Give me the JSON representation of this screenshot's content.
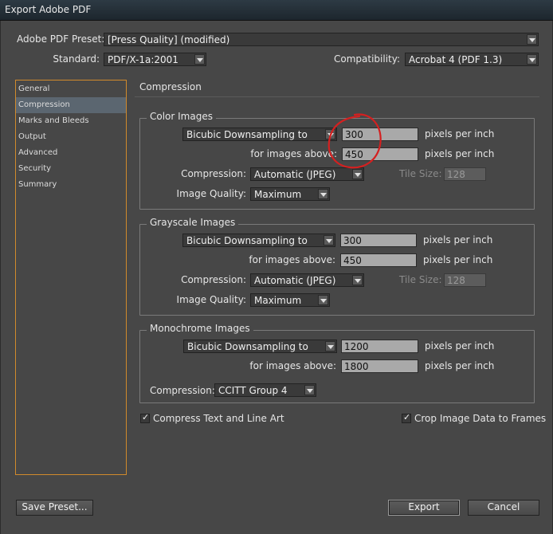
{
  "window": {
    "title": "Export Adobe PDF"
  },
  "header": {
    "preset_label": "Adobe PDF Preset:",
    "preset_value": "[Press Quality] (modified)",
    "standard_label": "Standard:",
    "standard_value": "PDF/X-1a:2001",
    "compat_label": "Compatibility:",
    "compat_value": "Acrobat 4 (PDF 1.3)"
  },
  "sidebar": {
    "items": [
      {
        "label": "General"
      },
      {
        "label": "Compression"
      },
      {
        "label": "Marks and Bleeds"
      },
      {
        "label": "Output"
      },
      {
        "label": "Advanced"
      },
      {
        "label": "Security"
      },
      {
        "label": "Summary"
      }
    ],
    "selected": "Compression"
  },
  "main": {
    "section_title": "Compression",
    "color": {
      "title": "Color Images",
      "sampling": "Bicubic Downsampling to",
      "ppi_value": "300",
      "ppi_unit": "pixels per inch",
      "above_label": "for images above:",
      "above_value": "450",
      "above_unit": "pixels per inch",
      "compression_label": "Compression:",
      "compression_value": "Automatic (JPEG)",
      "tile_label": "Tile Size:",
      "tile_value": "128",
      "quality_label": "Image Quality:",
      "quality_value": "Maximum"
    },
    "gray": {
      "title": "Grayscale Images",
      "sampling": "Bicubic Downsampling to",
      "ppi_value": "300",
      "ppi_unit": "pixels per inch",
      "above_label": "for images above:",
      "above_value": "450",
      "above_unit": "pixels per inch",
      "compression_label": "Compression:",
      "compression_value": "Automatic (JPEG)",
      "tile_label": "Tile Size:",
      "tile_value": "128",
      "quality_label": "Image Quality:",
      "quality_value": "Maximum"
    },
    "mono": {
      "title": "Monochrome Images",
      "sampling": "Bicubic Downsampling to",
      "ppi_value": "1200",
      "ppi_unit": "pixels per inch",
      "above_label": "for images above:",
      "above_value": "1800",
      "above_unit": "pixels per inch",
      "compression_label": "Compression:",
      "compression_value": "CCITT Group 4"
    },
    "compress_text": {
      "label": "Compress Text and Line Art",
      "checked": true
    },
    "crop_image": {
      "label": "Crop Image Data to Frames",
      "checked": true
    }
  },
  "footer": {
    "save_preset": "Save Preset...",
    "export": "Export",
    "cancel": "Cancel"
  },
  "colors": {
    "annotation": "#d42020",
    "sidebar_border": "#d18a2c",
    "selection": "#5b6670"
  }
}
